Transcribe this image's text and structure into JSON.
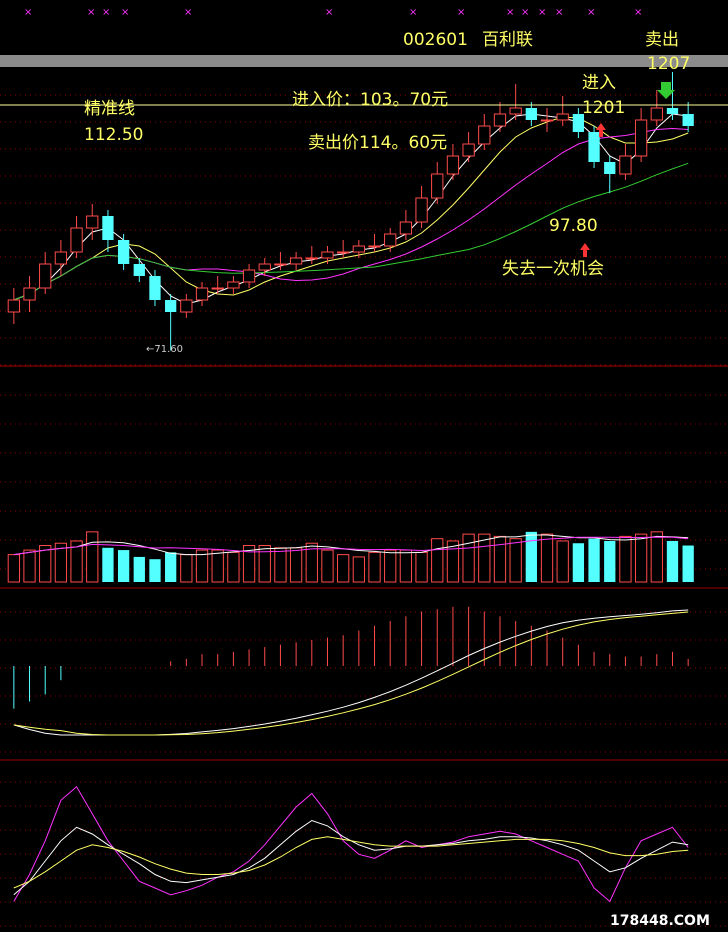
{
  "header": {
    "stock_code": "002601",
    "stock_name": "百利联"
  },
  "annotations": {
    "precise_line_label": "精准线",
    "precise_line_value": "112.50",
    "entry_price": "进入价：103。70元",
    "sell_price": "卖出价114。60元",
    "sell_label": "卖出",
    "sell_date": "1207",
    "entry_label": "进入",
    "entry_date": "1201",
    "low_value": "97.80",
    "missed_chance": "失去一次机会",
    "bottom_low": "←71.60"
  },
  "watermark": "178448.COM",
  "colors": {
    "up": "#ff4b4b",
    "down": "#54ffff",
    "ma_white": "#ffffff",
    "ma_yellow": "#ffff66",
    "ma_magenta": "#ff33ff",
    "ma_green": "#33cc33",
    "precise_line": "#ffff99",
    "label_yellow": "#ffff66",
    "panel_divider": "#a00000",
    "grid": "#8b0000"
  },
  "chart_data": [
    {
      "type": "candlestick",
      "title": "",
      "x": [
        1,
        2,
        3,
        4,
        5,
        6,
        7,
        8,
        9,
        10,
        11,
        12,
        13,
        14,
        15,
        16,
        17,
        18,
        19,
        20,
        21,
        22,
        23,
        24,
        25,
        26,
        27,
        28,
        29,
        30,
        31,
        32,
        33,
        34,
        35,
        36,
        37,
        38,
        39,
        40,
        41,
        42,
        43,
        44
      ],
      "open": [
        78,
        80,
        82,
        86,
        88,
        92,
        94,
        90,
        86,
        84,
        80,
        78,
        80,
        82,
        82,
        83,
        85,
        86,
        86,
        87,
        87,
        88,
        88,
        89,
        89,
        91,
        93,
        97,
        101,
        104,
        106,
        109,
        111,
        112,
        110,
        110,
        111,
        108,
        103,
        101,
        104,
        110,
        112,
        111
      ],
      "close": [
        80,
        82,
        86,
        88,
        92,
        94,
        90,
        86,
        84,
        80,
        78,
        80,
        82,
        82,
        83,
        85,
        86,
        86,
        87,
        87,
        88,
        88,
        89,
        89,
        91,
        93,
        97,
        101,
        104,
        106,
        109,
        111,
        112,
        110,
        110,
        111,
        108,
        103,
        101,
        104,
        110,
        112,
        111,
        109
      ],
      "high": [
        82,
        84,
        88,
        90,
        94,
        96,
        95,
        91,
        87,
        85,
        81,
        81,
        83,
        84,
        84,
        86,
        87,
        88,
        88,
        89,
        89,
        90,
        90,
        91,
        92,
        95,
        99,
        103,
        106,
        108,
        111,
        113,
        116,
        113,
        112,
        114,
        112,
        109,
        104,
        106,
        112,
        115,
        118,
        113
      ],
      "low": [
        76,
        78,
        81,
        84,
        87,
        90,
        88,
        85,
        83,
        79,
        71.6,
        77,
        79,
        81,
        81,
        82,
        84,
        85,
        85,
        86,
        86,
        87,
        87,
        88,
        88,
        90,
        92,
        96,
        100,
        103,
        105,
        108,
        110,
        109,
        108,
        109,
        107,
        102,
        97.8,
        100,
        103,
        109,
        110,
        108
      ],
      "ylim": [
        70,
        120
      ],
      "precise_line": 112.5,
      "grid": true
    },
    {
      "type": "bar",
      "title": "",
      "values": [
        12,
        14,
        16,
        17,
        18,
        22,
        15,
        14,
        11,
        10,
        13,
        12,
        14,
        14,
        13,
        16,
        16,
        15,
        15,
        17,
        14,
        12,
        11,
        13,
        14,
        14,
        13,
        19,
        18,
        21,
        21,
        20,
        19,
        22,
        21,
        18,
        17,
        19,
        18,
        20,
        21,
        22,
        18,
        16
      ],
      "ylim": [
        0,
        25
      ]
    },
    {
      "type": "bar",
      "title": "",
      "values": [
        -1.8,
        -1.5,
        -1.2,
        -0.6,
        0,
        0,
        0,
        0,
        0,
        0,
        0.2,
        0.3,
        0.5,
        0.5,
        0.6,
        0.7,
        0.8,
        0.9,
        1.0,
        1.1,
        1.2,
        1.3,
        1.5,
        1.7,
        1.9,
        2.1,
        2.3,
        2.4,
        2.5,
        2.5,
        2.3,
        2.1,
        1.9,
        1.7,
        1.5,
        1.2,
        0.9,
        0.6,
        0.5,
        0.4,
        0.4,
        0.5,
        0.6,
        0.3
      ],
      "ylim": [
        -3,
        3
      ]
    },
    {
      "type": "line",
      "title": "",
      "x": [
        1,
        2,
        3,
        4,
        5,
        6,
        7,
        8,
        9,
        10,
        11,
        12,
        13,
        14,
        15,
        16,
        17,
        18,
        19,
        20,
        21,
        22,
        23,
        24,
        25,
        26,
        27,
        28,
        29,
        30,
        31,
        32,
        33,
        34,
        35,
        36,
        37,
        38,
        39,
        40,
        41,
        42,
        43,
        44
      ],
      "series": [
        {
          "values": [
            10,
            30,
            55,
            85,
            95,
            75,
            55,
            40,
            25,
            20,
            15,
            18,
            22,
            28,
            32,
            40,
            52,
            66,
            80,
            90,
            75,
            55,
            45,
            42,
            48,
            55,
            50,
            52,
            54,
            58,
            60,
            62,
            60,
            55,
            50,
            45,
            40,
            20,
            10,
            35,
            55,
            60,
            65,
            50
          ]
        },
        {
          "values": [
            15,
            25,
            40,
            55,
            65,
            60,
            52,
            45,
            38,
            30,
            25,
            24,
            26,
            28,
            30,
            35,
            42,
            52,
            62,
            70,
            66,
            58,
            52,
            48,
            49,
            51,
            51,
            52,
            53,
            55,
            56,
            58,
            58,
            57,
            55,
            52,
            48,
            40,
            32,
            35,
            42,
            48,
            54,
            52
          ]
        },
        {
          "values": [
            20,
            25,
            32,
            40,
            48,
            52,
            50,
            47,
            43,
            38,
            34,
            31,
            30,
            30,
            31,
            33,
            37,
            43,
            50,
            56,
            58,
            56,
            54,
            52,
            51,
            51,
            51,
            51,
            52,
            53,
            54,
            55,
            56,
            56,
            56,
            55,
            53,
            50,
            46,
            44,
            44,
            45,
            47,
            48
          ]
        }
      ],
      "ylim": [
        0,
        100
      ]
    }
  ]
}
